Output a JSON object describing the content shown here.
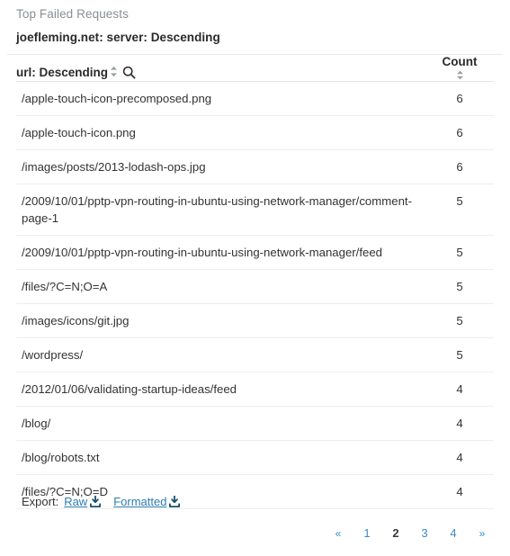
{
  "panel": {
    "title": "Top Failed Requests",
    "subtitle": "joefleming.net: server: Descending"
  },
  "table": {
    "columns": [
      {
        "key": "url",
        "label": "url: Descending",
        "sortable": true,
        "searchable": true,
        "sort_icon": "sort-updown-icon",
        "search_icon": "search-icon"
      },
      {
        "key": "count",
        "label": "Count",
        "sortable": true,
        "sort_icon": "sort-updown-icon"
      }
    ],
    "rows": [
      {
        "url": "/apple-touch-icon-precomposed.png",
        "count": "6"
      },
      {
        "url": "/apple-touch-icon.png",
        "count": "6"
      },
      {
        "url": "/images/posts/2013-lodash-ops.jpg",
        "count": "6"
      },
      {
        "url": "/2009/10/01/pptp-vpn-routing-in-ubuntu-using-network-manager/comment-page-1",
        "count": "5"
      },
      {
        "url": "/2009/10/01/pptp-vpn-routing-in-ubuntu-using-network-manager/feed",
        "count": "5"
      },
      {
        "url": "/files/?C=N;O=A",
        "count": "5"
      },
      {
        "url": "/images/icons/git.jpg",
        "count": "5"
      },
      {
        "url": "/wordpress/",
        "count": "5"
      },
      {
        "url": "/2012/01/06/validating-startup-ideas/feed",
        "count": "4"
      },
      {
        "url": "/blog/",
        "count": "4"
      },
      {
        "url": "/blog/robots.txt",
        "count": "4"
      },
      {
        "url": "/files/?C=N;O=D",
        "count": "4"
      }
    ]
  },
  "export": {
    "label": "Export:",
    "raw_label": "Raw",
    "formatted_label": "Formatted",
    "icon": "download-icon"
  },
  "pagination": {
    "prev_label": "«",
    "next_label": "»",
    "pages": [
      "1",
      "2",
      "3",
      "4"
    ],
    "active_page": "2"
  },
  "colors": {
    "link": "#2c7cb0",
    "pager_link": "#3a8bc4",
    "title": "#8a8f94",
    "text": "#333333",
    "rule": "#e6eaec",
    "row_rule": "#eceeef"
  }
}
